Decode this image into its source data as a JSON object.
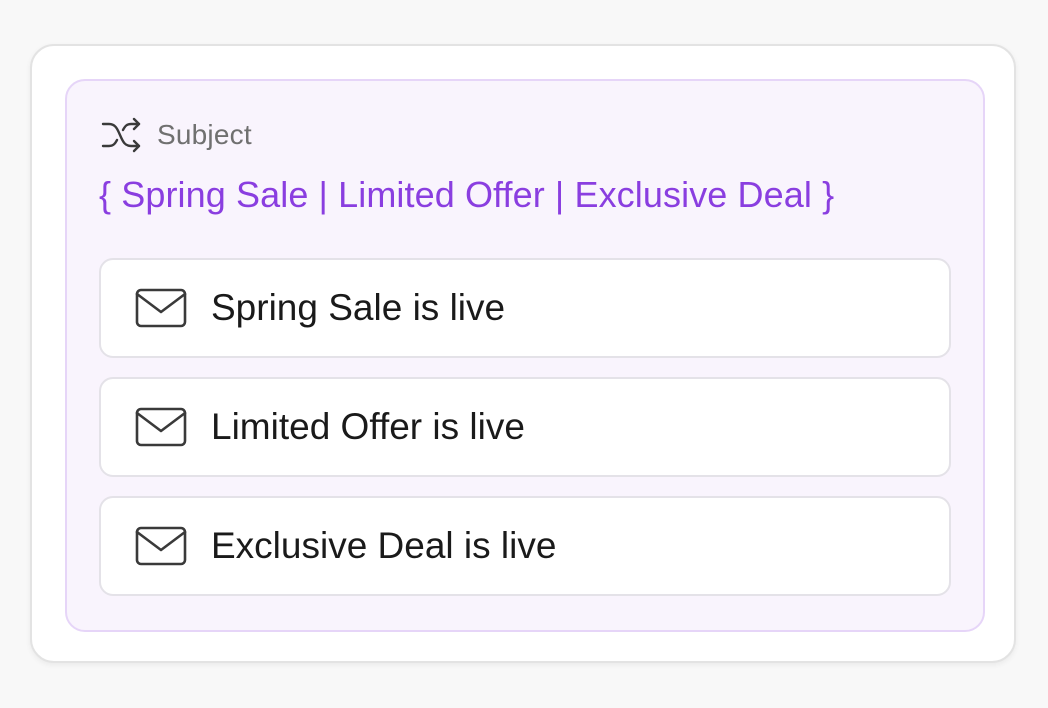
{
  "subject_block": {
    "icon": "shuffle-icon",
    "label": "Subject",
    "spintax": "{ Spring Sale | Limited Offer | Exclusive Deal }",
    "accent_color": "#8a3ee0"
  },
  "variants": [
    {
      "icon": "mail-icon",
      "text": "Spring Sale is live"
    },
    {
      "icon": "mail-icon",
      "text": "Limited Offer is live"
    },
    {
      "icon": "mail-icon",
      "text": "Exclusive Deal is live"
    }
  ]
}
